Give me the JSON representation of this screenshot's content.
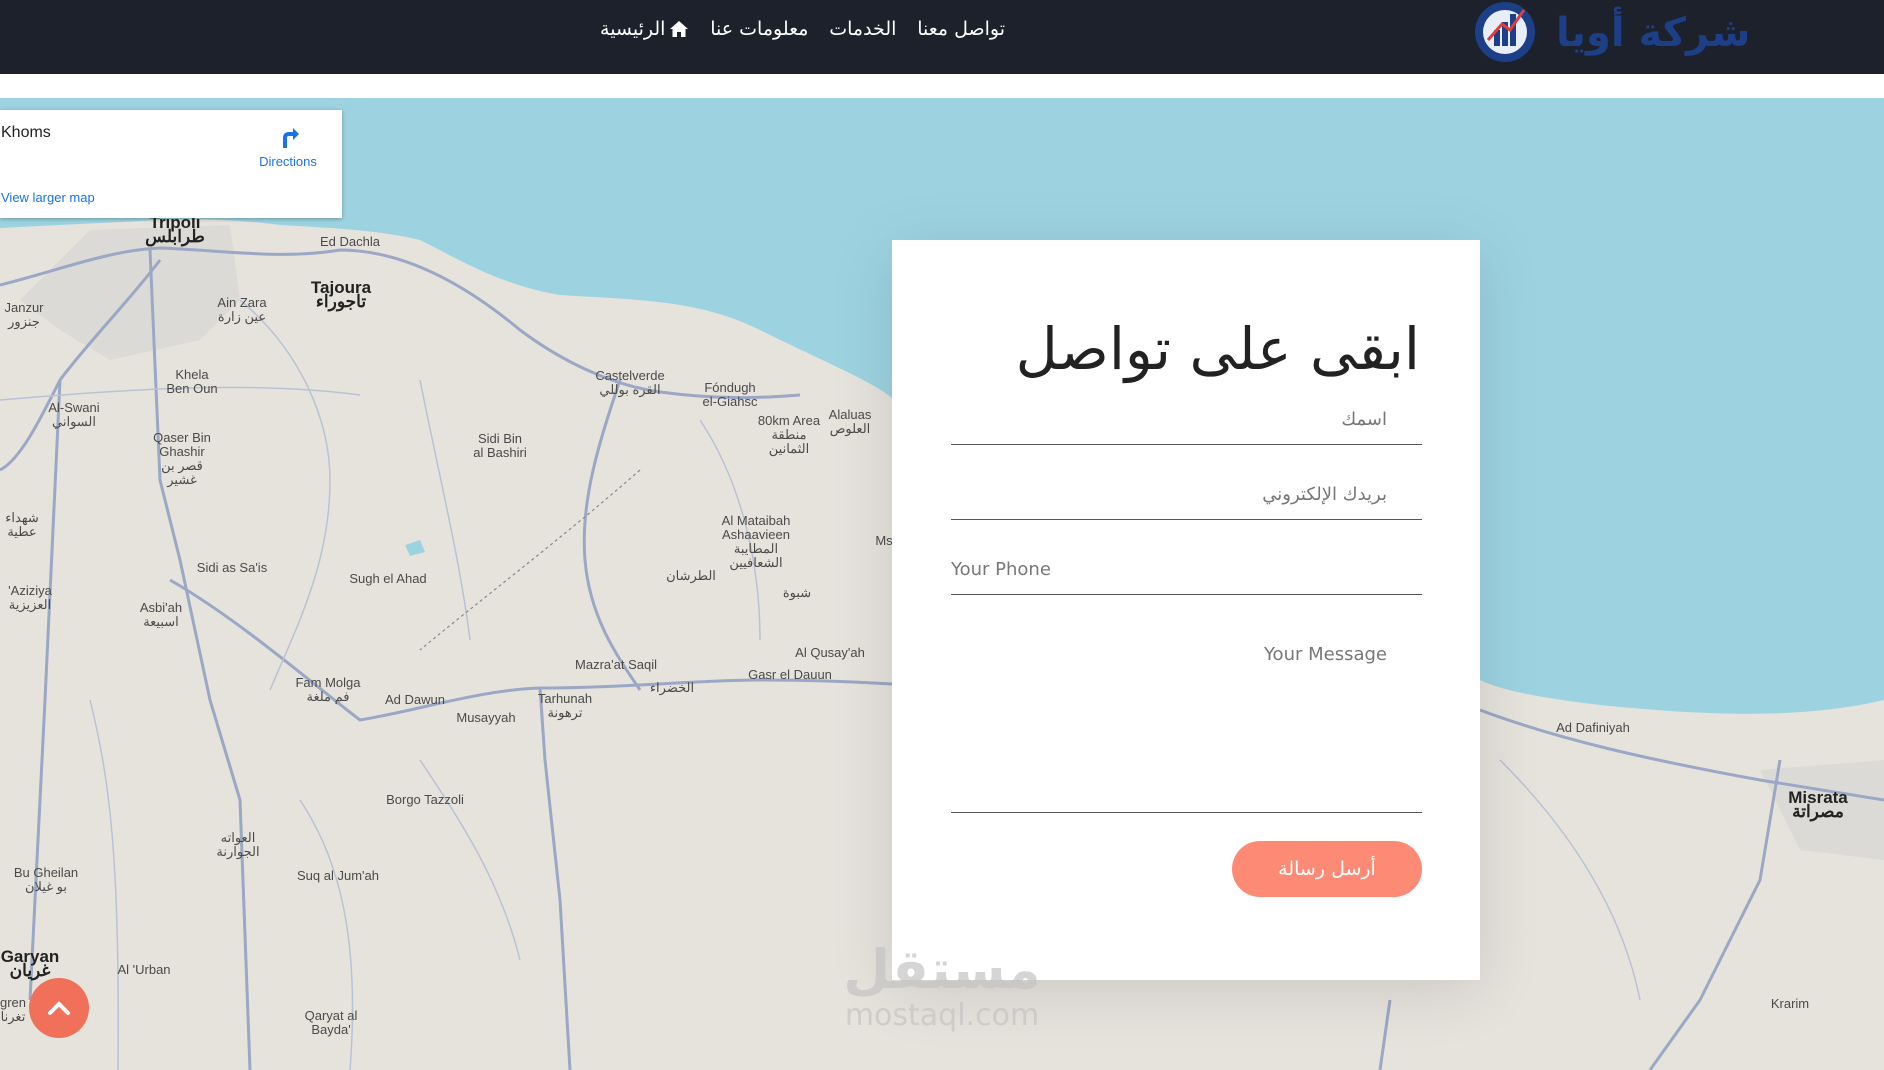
{
  "colors": {
    "nav_bg": "#1c212b",
    "accent": "#fd8a74",
    "sea": "#9dd3e1",
    "land": "#e6e3dd",
    "road": "#9aa8c6",
    "link": "#1a73e8",
    "logo": "#1d3f87"
  },
  "navbar": {
    "logo_text": "شركة أويا",
    "links": [
      {
        "label": "الرئيسية",
        "icon": "home-icon"
      },
      {
        "label": "معلومات عنا"
      },
      {
        "label": "الخدمات"
      },
      {
        "label": "تواصل معنا"
      }
    ]
  },
  "map": {
    "info": {
      "place": "Khoms",
      "directions": "Directions",
      "larger": "View larger map"
    },
    "labels": [
      {
        "text": "Tripoli\nطرابلس",
        "big": true
      },
      {
        "text": "Ed Dachla"
      },
      {
        "text": "Tajoura\nتاجوراء",
        "big": true
      },
      {
        "text": "Janzur\nجنزور"
      },
      {
        "text": "Ain Zara\nعين زارة"
      },
      {
        "text": "Khela\nBen Oun"
      },
      {
        "text": "Castelverde\nالقره بوللي"
      },
      {
        "text": "Fóndugh\nel-Giahsc"
      },
      {
        "text": "Al-Swani\nالسواني"
      },
      {
        "text": "Sidi Bin\nal Bashiri"
      },
      {
        "text": "80km Area\nمنطقة\nالثمانين"
      },
      {
        "text": "Alaluas\nالعلوص"
      },
      {
        "text": "Qaser Bin\nGhashir\nقصر بن\nغشير"
      },
      {
        "text": "شهداء\nعطية"
      },
      {
        "text": "Al Mataibah\nAshaavieen\nالمطايبة\nالشعافيين"
      },
      {
        "text": "Ms"
      },
      {
        "text": "Sidi as Sa'is"
      },
      {
        "text": "Sugh el Ahad"
      },
      {
        "text": "الطرشان"
      },
      {
        "text": "شبوة"
      },
      {
        "text": "'Aziziya\nالعزيزية"
      },
      {
        "text": "Asbi'ah\nاسبيعة"
      },
      {
        "text": "Al Qusay'ah"
      },
      {
        "text": "Mazra'at Saqil"
      },
      {
        "text": "Gasr el Dauun"
      },
      {
        "text": "الخضراء"
      },
      {
        "text": "Fam Molga\nفم ملغة"
      },
      {
        "text": "Ad Dawun"
      },
      {
        "text": "Tarhunah\nترهونة"
      },
      {
        "text": "Musayyah"
      },
      {
        "text": "Borgo Tazzoli"
      },
      {
        "text": "العواته\nالجوارنة"
      },
      {
        "text": "Bu Gheilan\nبو غيلان"
      },
      {
        "text": "Suq al Jum'ah"
      },
      {
        "text": "Garyan\nغريان",
        "big": true
      },
      {
        "text": "Al 'Urban"
      },
      {
        "text": "Qaryat al\nBayda'"
      },
      {
        "text": "gren\nتغرنا"
      },
      {
        "text": "Ad Dafiniyah"
      },
      {
        "text": "Misrata\nمصراتة",
        "big": true
      },
      {
        "text": "Krarim"
      }
    ]
  },
  "contact": {
    "title": "ابقى على تواصل",
    "name_placeholder": "اسمك",
    "email_placeholder": "بريدك الإلكتروني",
    "phone_placeholder": "Your Phone",
    "message_placeholder": "Your Message",
    "send_label": "أرسل رسالة"
  },
  "watermark": {
    "arabic": "مستقل",
    "latin": "mostaql.com"
  }
}
